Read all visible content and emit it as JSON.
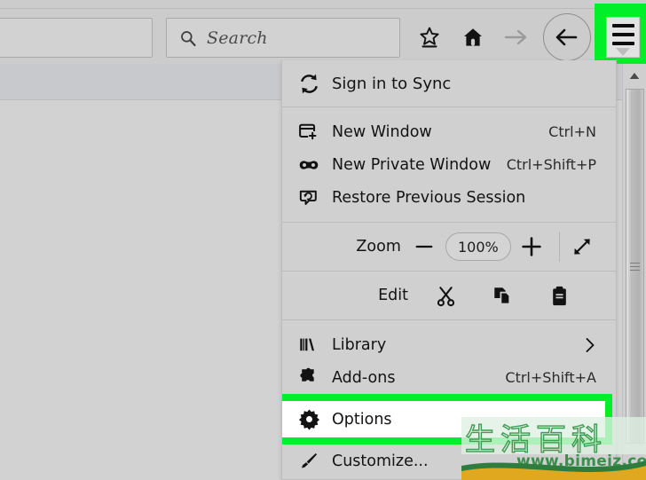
{
  "browser": {
    "urlbar": {
      "value": "",
      "placeholder": ""
    },
    "search": {
      "value": "",
      "placeholder": "Search",
      "icon": "search-icon"
    },
    "toolbar_icons": [
      {
        "name": "bookmark-star-icon",
        "label": "Bookmark this page"
      },
      {
        "name": "home-icon",
        "label": "Home"
      },
      {
        "name": "forward-arrow-icon",
        "label": "Forward"
      },
      {
        "name": "back-arrow-icon",
        "label": "Back"
      }
    ],
    "menu_button": {
      "name": "hamburger-menu-button",
      "label": "Open menu",
      "highlighted": true
    }
  },
  "menu": {
    "sync": {
      "label": "Sign in to Sync",
      "icon": "sync-icon",
      "shortcut": ""
    },
    "items": [
      {
        "label": "New Window",
        "icon": "new-window-icon",
        "shortcut": "Ctrl+N"
      },
      {
        "label": "New Private Window",
        "icon": "mask-icon",
        "shortcut": "Ctrl+Shift+P"
      },
      {
        "label": "Restore Previous Session",
        "icon": "restore-session-icon",
        "shortcut": ""
      }
    ],
    "zoom": {
      "label": "Zoom",
      "minus_label": "−",
      "value": "100%",
      "plus_label": "+",
      "fullscreen_icon": "fullscreen-icon"
    },
    "edit": {
      "label": "Edit",
      "cut_icon": "cut-scissors-icon",
      "copy_icon": "copy-pages-icon",
      "paste_icon": "paste-clipboard-icon"
    },
    "library": {
      "label": "Library",
      "icon": "library-books-icon",
      "chevron": "chevron-right-icon"
    },
    "addons": {
      "label": "Add-ons",
      "icon": "puzzle-piece-icon",
      "shortcut": "Ctrl+Shift+A"
    },
    "options": {
      "label": "Options",
      "icon": "gear-icon",
      "highlighted": true
    },
    "customize": {
      "label": "Customize...",
      "icon": "paintbrush-icon",
      "shortcut": ""
    }
  },
  "scrollbar": {
    "up_arrow": "scroll-up-arrow-icon",
    "grip": "scrollbar-grip-icon"
  },
  "watermark": {
    "cjk_text": "生活百科",
    "url": "www.bimeiz.com"
  },
  "colors": {
    "highlight_green": "#00ef2a",
    "menu_bg": "#d0d0d0",
    "toolbar_bg": "#cccccc",
    "page_bg": "#d2d2d2",
    "selected_row_bg": "#ffffff"
  }
}
